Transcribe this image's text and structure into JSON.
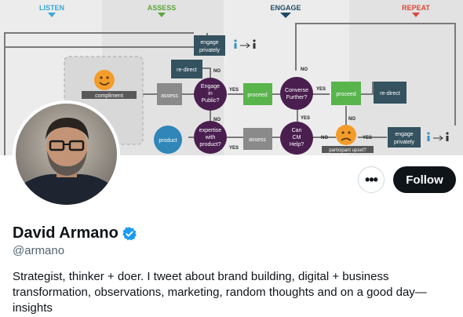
{
  "banner": {
    "stages": [
      {
        "label": "LISTEN",
        "color": "#3aa7d6"
      },
      {
        "label": "ASSESS",
        "color": "#5ca53a"
      },
      {
        "label": "ENGAGE",
        "color": "#1f4a63"
      },
      {
        "label": "REPEAT",
        "color": "#d8483a"
      }
    ],
    "nodes": {
      "compliment": "compliment",
      "assess1": "assess",
      "redirect1": "re-direct",
      "engage_privately1": [
        "engage",
        "privately"
      ],
      "engage_public": [
        "Engage",
        "in",
        "Public?"
      ],
      "proceed1": "proceed",
      "converse": [
        "Converse",
        "Further?"
      ],
      "proceed2": "proceed",
      "redirect2": "re-direct",
      "product": "product",
      "expertise": [
        "expertise",
        "with",
        "product?"
      ],
      "assess2": "assess",
      "cm_help": [
        "Can",
        "CM",
        "Help?"
      ],
      "participant_upset": "participant upset?",
      "engage_privately2": [
        "engage",
        "privately"
      ],
      "yes": "YES",
      "no": "NO"
    }
  },
  "profile": {
    "display_name": "David Armano",
    "handle": "@armano",
    "bio": "Strategist, thinker + doer. I tweet about brand building, digital + business transformation, observations, marketing, random thoughts and on a good day—insights",
    "more_label": "•••",
    "follow_label": "Follow"
  },
  "colors": {
    "verified": "#1d9bf0",
    "follow_bg": "#0f1419",
    "handle": "#536471"
  }
}
